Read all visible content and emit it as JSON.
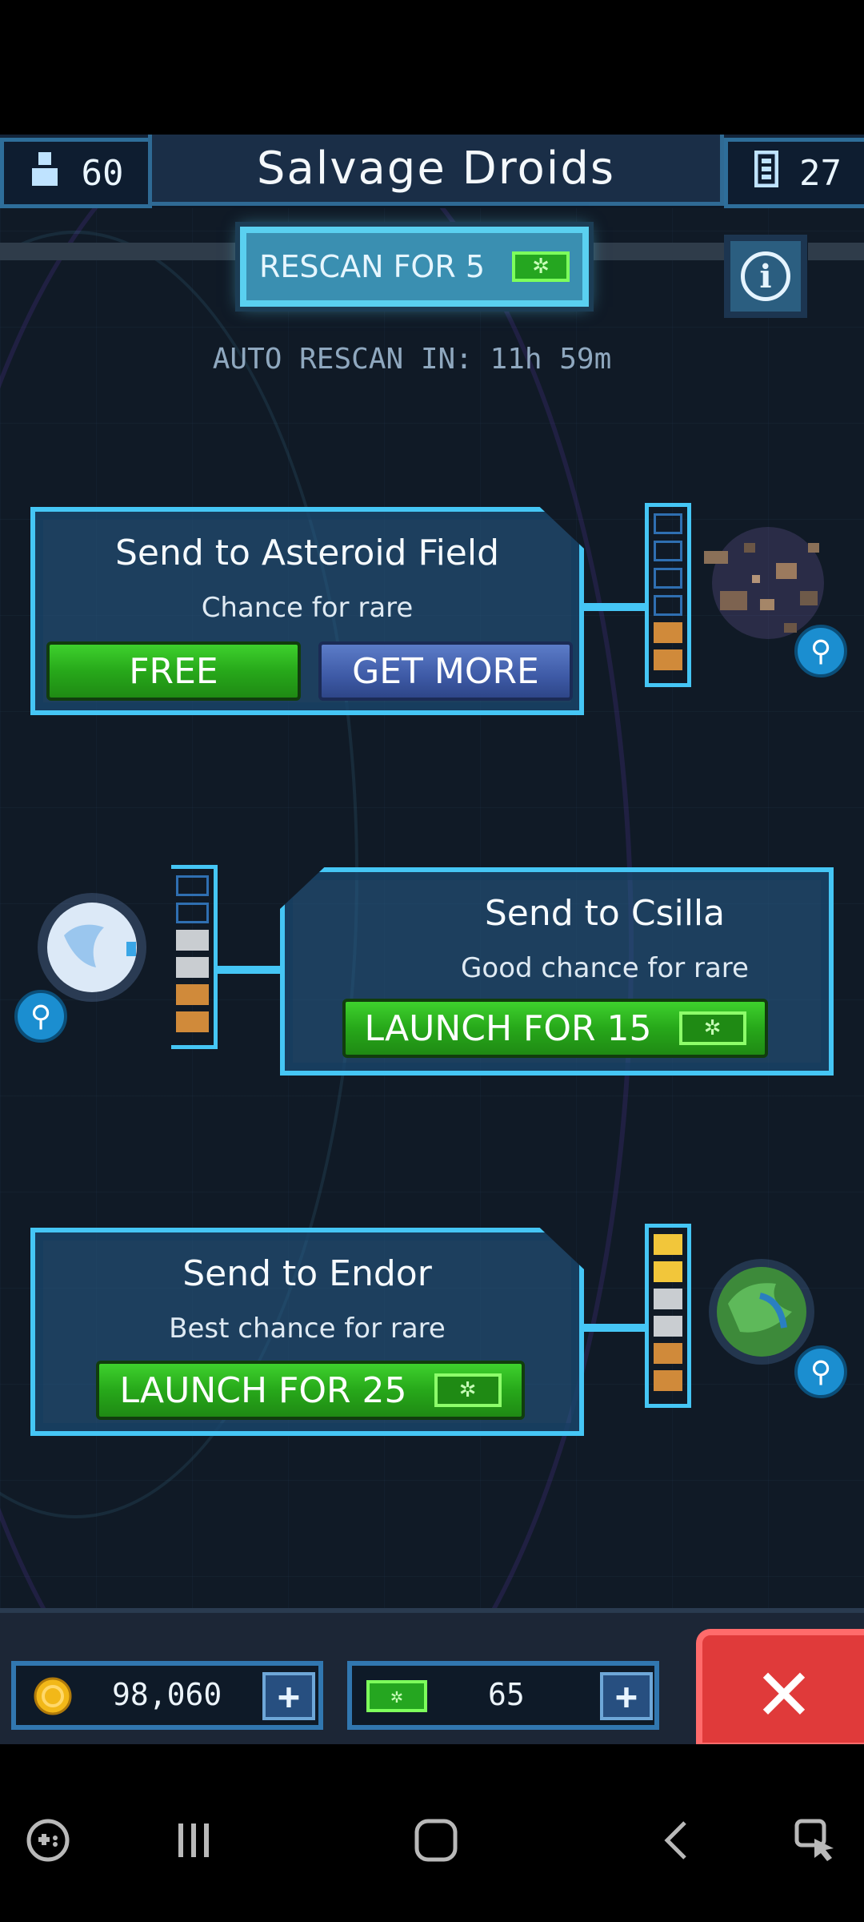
{
  "header": {
    "crew_count": "60",
    "title": "Salvage Droids",
    "cards_count": "27"
  },
  "rescan": {
    "label": "RESCAN FOR 5",
    "auto_rescan_text": "AUTO RESCAN IN: 11h 59m"
  },
  "missions": [
    {
      "title": "Send to Asteroid Field",
      "subtitle": "Chance for rare",
      "primary_button": "FREE",
      "secondary_button": "GET MORE",
      "rarity_meter": [
        "empty",
        "empty",
        "empty",
        "empty",
        "orange",
        "orange"
      ]
    },
    {
      "title": "Send to Csilla",
      "subtitle": "Good chance for rare",
      "primary_button": "LAUNCH FOR 15",
      "rarity_meter": [
        "empty",
        "empty",
        "white",
        "white",
        "orange",
        "orange"
      ]
    },
    {
      "title": "Send to Endor",
      "subtitle": "Best chance for rare",
      "primary_button": "LAUNCH FOR 25",
      "rarity_meter": [
        "yellow",
        "yellow",
        "white",
        "white",
        "orange",
        "orange"
      ]
    }
  ],
  "footer": {
    "coins": "98,060",
    "gems": "65"
  },
  "icons": {
    "crew": "person-icon",
    "cards": "cards-icon",
    "gem": "gem-icon",
    "coin": "coin-icon",
    "info": "info-icon",
    "zoom": "magnifier-icon",
    "close": "close-icon"
  },
  "colors": {
    "accent": "#45c6f5",
    "green_button": "#27a81a",
    "blue_button": "#3e5aa6",
    "close_button": "#e03a3a"
  }
}
